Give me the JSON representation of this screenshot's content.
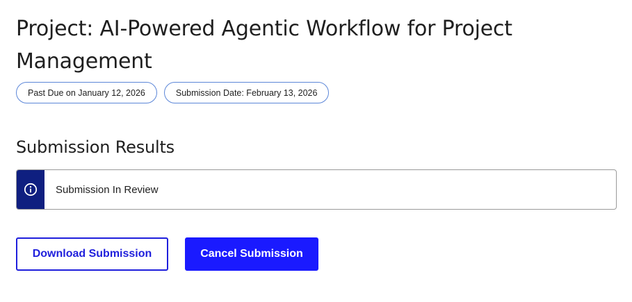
{
  "project": {
    "title": "Project: AI-Powered Agentic Workflow for Project Management"
  },
  "badges": {
    "due": "Past Due on January 12, 2026",
    "submission_date": "Submission Date: February 13, 2026"
  },
  "results": {
    "heading": "Submission Results",
    "status_icon": "info-icon",
    "status_text": "Submission In Review"
  },
  "actions": {
    "download_label": "Download Submission",
    "cancel_label": "Cancel Submission"
  },
  "colors": {
    "accent": "#1a1aff",
    "status_bar": "#0f1f80",
    "badge_border": "#5b86d8"
  }
}
